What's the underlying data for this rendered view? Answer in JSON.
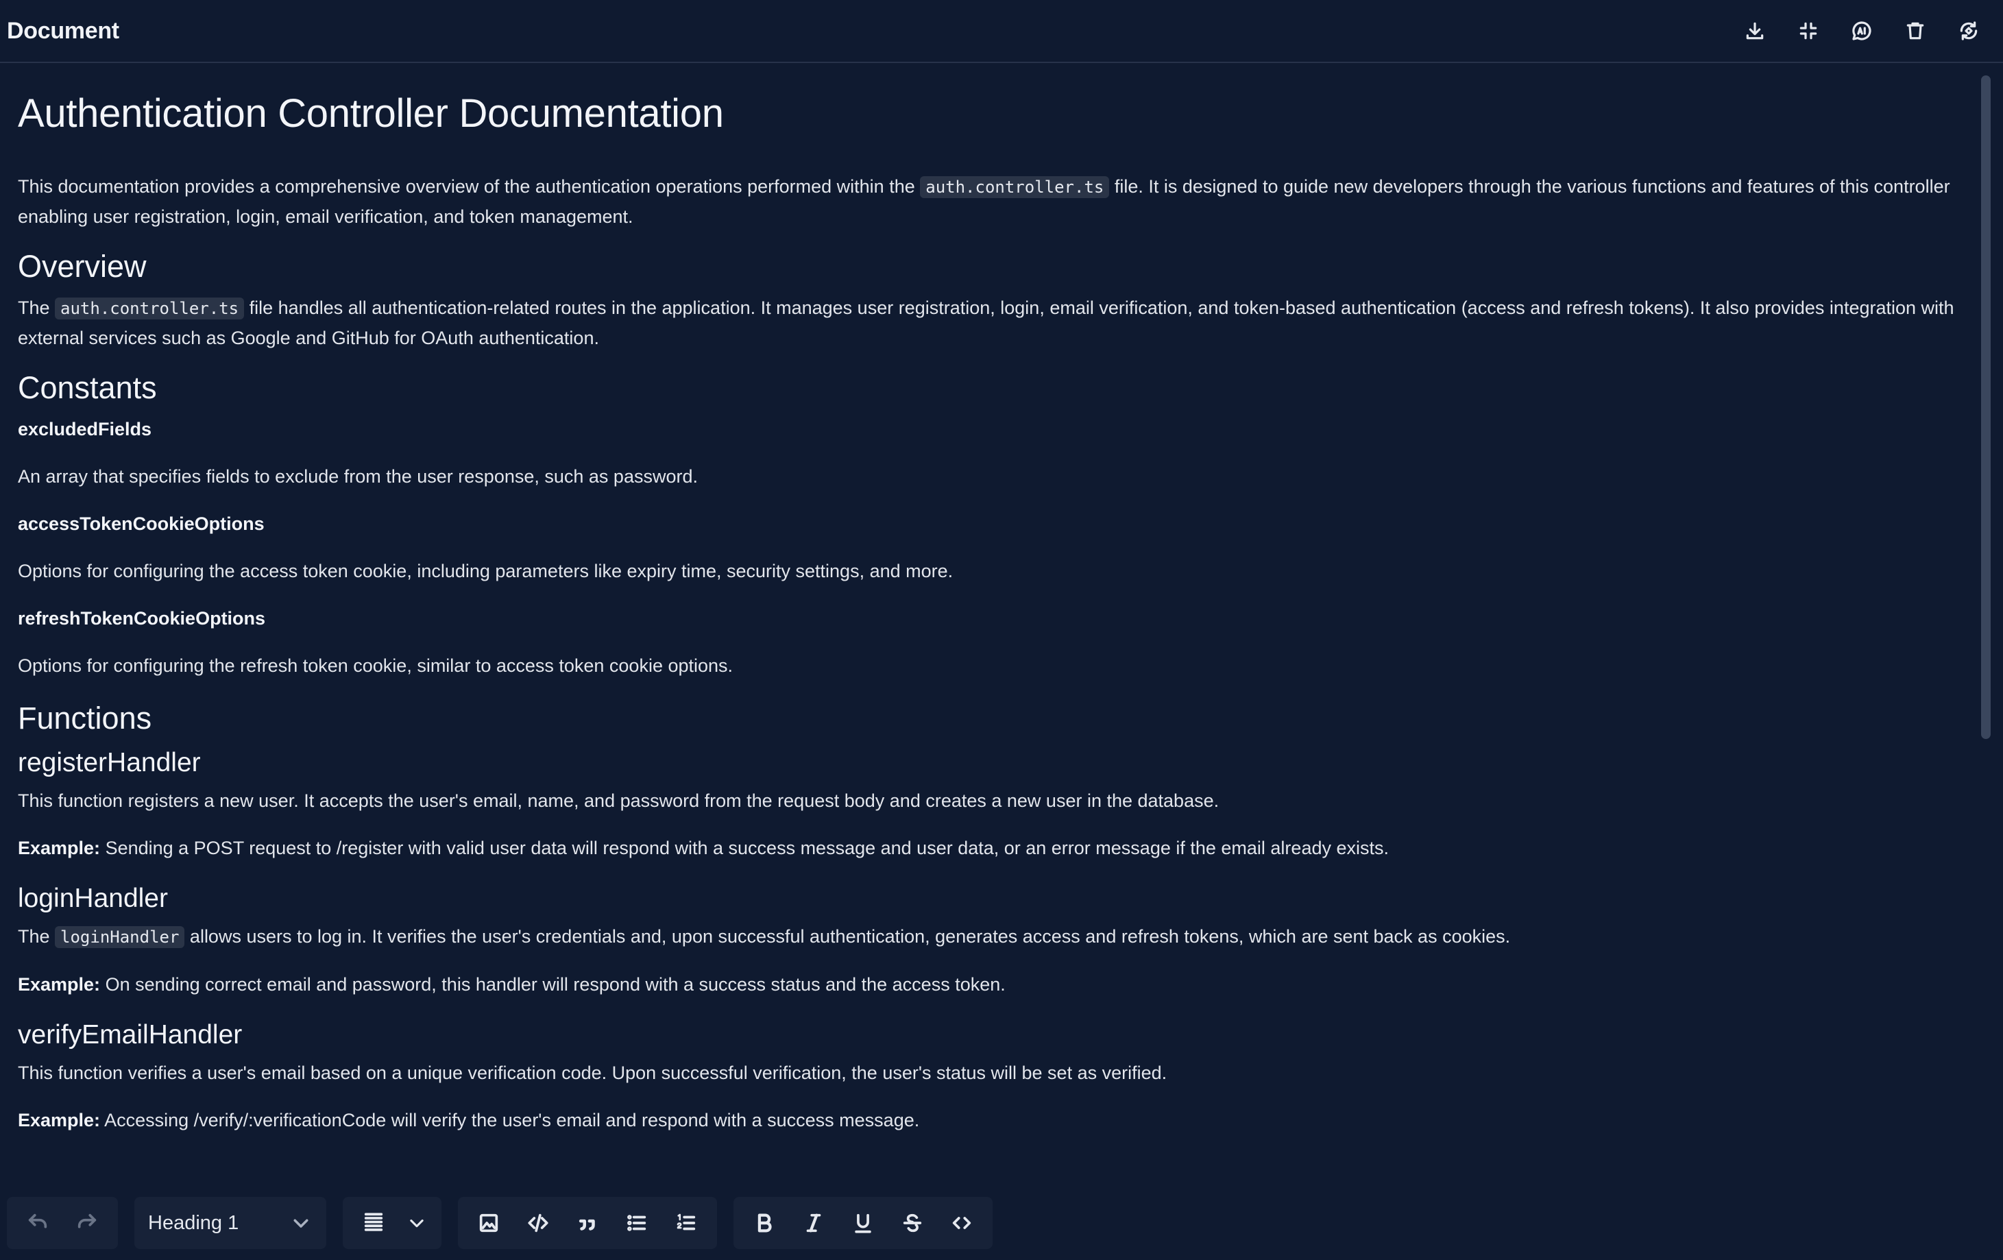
{
  "header": {
    "title": "Document",
    "actions": [
      {
        "icon": "download-icon"
      },
      {
        "icon": "collapse-icon"
      },
      {
        "icon": "ai-chat-icon"
      },
      {
        "icon": "trash-icon"
      },
      {
        "icon": "sync-icon"
      }
    ]
  },
  "doc": {
    "title": "Authentication Controller Documentation",
    "intro": {
      "before": "This documentation provides a comprehensive overview of the authentication operations performed within the ",
      "code": "auth.controller.ts",
      "after": " file. It is designed to guide new developers through the various functions and features of this controller enabling user registration, login, email verification, and token management."
    },
    "overview": {
      "heading": "Overview",
      "before": "The ",
      "code": "auth.controller.ts",
      "after": " file handles all authentication-related routes in the application. It manages user registration, login, email verification, and token-based authentication (access and refresh tokens). It also provides integration with external services such as Google and GitHub for OAuth authentication."
    },
    "constants": {
      "heading": "Constants",
      "items": [
        {
          "name": "excludedFields",
          "desc": "An array that specifies fields to exclude from the user response, such as password."
        },
        {
          "name": "accessTokenCookieOptions",
          "desc": "Options for configuring the access token cookie, including parameters like expiry time, security settings, and more."
        },
        {
          "name": "refreshTokenCookieOptions",
          "desc": "Options for configuring the refresh token cookie, similar to access token cookie options."
        }
      ]
    },
    "functions": {
      "heading": "Functions",
      "register": {
        "name": "registerHandler",
        "desc": "This function registers a new user. It accepts the user's email, name, and password from the request body and creates a new user in the database.",
        "example_label": "Example:",
        "example": " Sending a POST request to /register with valid user data will respond with a success message and user data, or an error message if the email already exists."
      },
      "login": {
        "name": "loginHandler",
        "before": "The ",
        "code": "loginHandler",
        "after": " allows users to log in. It verifies the user's credentials and, upon successful authentication, generates access and refresh tokens, which are sent back as cookies.",
        "example_label": "Example:",
        "example": " On sending correct email and password, this handler will respond with a success status and the access token."
      },
      "verify": {
        "name": "verifyEmailHandler",
        "desc": "This function verifies a user's email based on a unique verification code. Upon successful verification, the user's status will be set as verified.",
        "example_label": "Example:",
        "example": " Accessing /verify/:verificationCode will verify the user's email and respond with a success message."
      }
    }
  },
  "toolbar": {
    "block_type": "Heading 1"
  }
}
